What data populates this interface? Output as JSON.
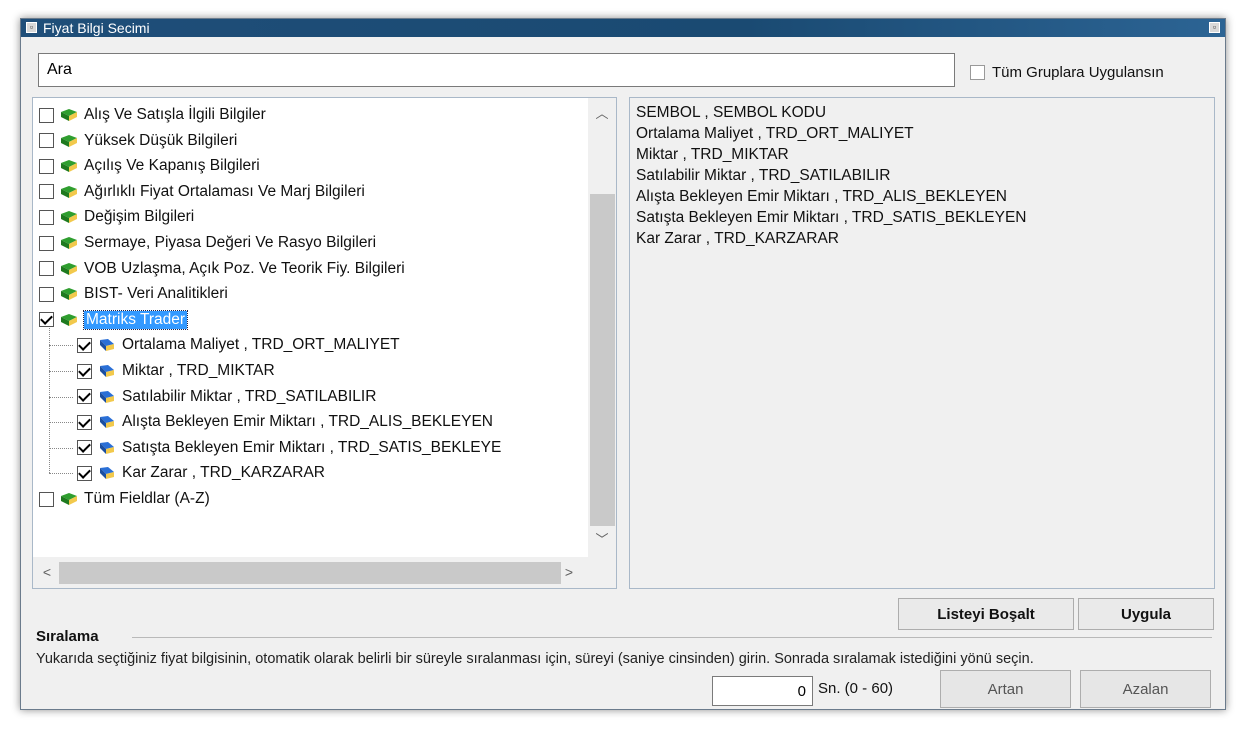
{
  "window": {
    "title": "Fiyat Bilgi Secimi"
  },
  "search": {
    "value": "Ara"
  },
  "apply_all": {
    "label": "Tüm Gruplara Uygulansın",
    "checked": false
  },
  "tree": {
    "groups_before": [
      {
        "label": "Alış Ve Satışla İlgili Bilgiler",
        "checked": false
      },
      {
        "label": "Yüksek Düşük Bilgileri",
        "checked": false
      },
      {
        "label": "Açılış Ve Kapanış Bilgileri",
        "checked": false
      },
      {
        "label": "Ağırlıklı Fiyat Ortalaması Ve Marj Bilgileri",
        "checked": false
      },
      {
        "label": "Değişim Bilgileri",
        "checked": false
      },
      {
        "label": "Sermaye, Piyasa Değeri Ve Rasyo Bilgileri",
        "checked": false
      },
      {
        "label": "VOB Uzlaşma, Açık Poz. Ve Teorik Fiy. Bilgileri",
        "checked": false
      },
      {
        "label": "BIST- Veri Analitikleri",
        "checked": false
      }
    ],
    "selected_group": {
      "label": "Matriks Trader",
      "checked": true
    },
    "children": [
      {
        "label": "Ortalama Maliyet , TRD_ORT_MALIYET",
        "checked": true
      },
      {
        "label": "Miktar , TRD_MIKTAR",
        "checked": true
      },
      {
        "label": "Satılabilir Miktar , TRD_SATILABILIR",
        "checked": true
      },
      {
        "label": "Alışta Bekleyen Emir Miktarı , TRD_ALIS_BEKLEYEN",
        "checked": true
      },
      {
        "label": "Satışta Bekleyen Emir Miktarı , TRD_SATIS_BEKLEYE",
        "checked": true
      },
      {
        "label": "Kar Zarar , TRD_KARZARAR",
        "checked": true
      }
    ],
    "last_group": {
      "label": "Tüm Fieldlar (A-Z)",
      "checked": false
    }
  },
  "selected_fields": [
    "SEMBOL , SEMBOL KODU",
    "Ortalama Maliyet , TRD_ORT_MALIYET",
    "Miktar , TRD_MIKTAR",
    "Satılabilir Miktar , TRD_SATILABILIR",
    "Alışta Bekleyen Emir Miktarı , TRD_ALIS_BEKLEYEN",
    "Satışta Bekleyen Emir Miktarı , TRD_SATIS_BEKLEYEN",
    "Kar Zarar , TRD_KARZARAR"
  ],
  "buttons": {
    "clear_list": "Listeyi Boşalt",
    "apply": "Uygula",
    "ascending": "Artan",
    "descending": "Azalan"
  },
  "sorting": {
    "title": "Sıralama",
    "description": "Yukarıda seçtiğiniz fiyat bilgisinin, otomatik olarak belirli bir süreyle sıralanması için, süreyi (saniye cinsinden) girin. Sonrada sıralamak istediğini yönü seçin.",
    "seconds_value": "0",
    "seconds_label": "Sn. (0 - 60)"
  },
  "colors": {
    "titlebar": "#1f4e79",
    "selection": "#3399ff",
    "group_icon": "#2f9e2f",
    "field_icon": "#2a6fd6"
  },
  "icons": {
    "group": "green-book-icon",
    "field": "blue-book-icon"
  }
}
